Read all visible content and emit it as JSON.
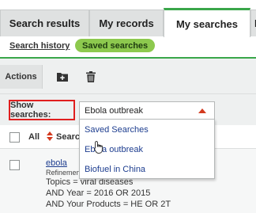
{
  "tabs": [
    {
      "label": "Search results"
    },
    {
      "label": "My records"
    },
    {
      "label": "My searches",
      "active": true
    },
    {
      "label": "M"
    }
  ],
  "subnav": {
    "history_link": "Search history",
    "saved_pill": "Saved searches"
  },
  "actions": {
    "label": "Actions",
    "icons": [
      "folder-add-icon",
      "trash-icon"
    ]
  },
  "show_searches": {
    "label": "Show searches:",
    "selected": "Ebola outbreak"
  },
  "dropdown": {
    "options": [
      "Saved Searches",
      "Ebola outbreak",
      "Biofuel in China"
    ]
  },
  "list_header": {
    "all_label": "All",
    "search_col": "Searc"
  },
  "rows": [
    {
      "name": "ebola",
      "refinement": "Refinemen",
      "lines": [
        "Topics = viral diseases",
        "AND Year = 2016 OR 2015",
        "AND Your Products = HE OR 2T"
      ]
    }
  ],
  "colors": {
    "accent_green": "#3aa64a",
    "pill_green": "#8dc94e",
    "highlight_red": "#e01f1f",
    "caret": "#d33a1f",
    "link_blue": "#1d3d8f"
  }
}
